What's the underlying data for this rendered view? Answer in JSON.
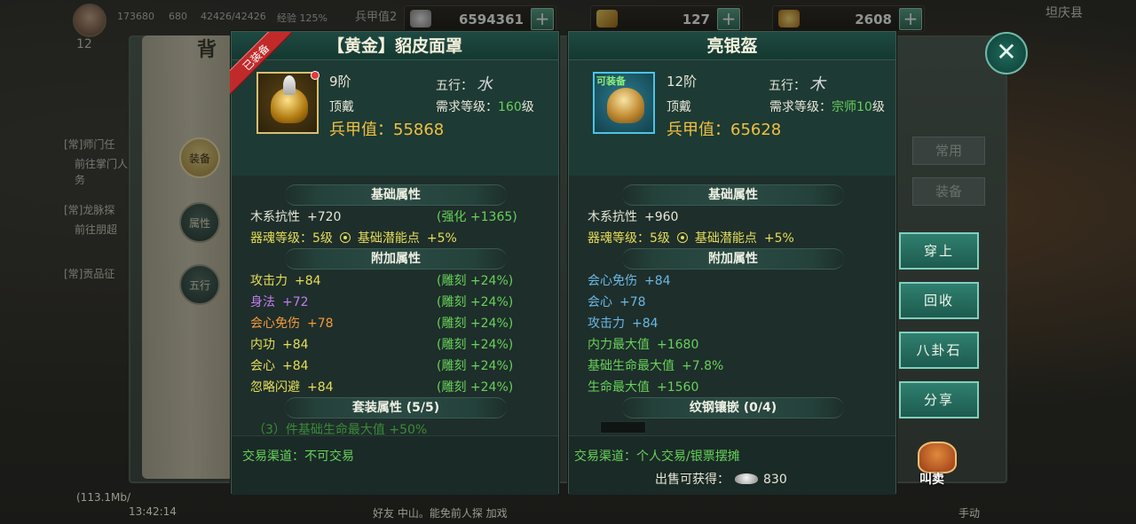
{
  "top_bar": {
    "stats": [
      "173680",
      "680",
      "42426/42426",
      "经验 125%"
    ],
    "armor_label": "兵甲值2",
    "resources": [
      {
        "icon": "silver-ingot-icon",
        "value": "6594361"
      },
      {
        "icon": "gold-bar-icon",
        "value": "127"
      },
      {
        "icon": "gold-ingot-icon",
        "value": "2608"
      }
    ],
    "right_label": "坦庆县"
  },
  "bag": {
    "title": "背",
    "side_tabs": [
      "装备",
      "属性",
      "五行"
    ],
    "right_tabs": [
      "常用",
      "装备"
    ],
    "actions": [
      "穿上",
      "回收",
      "八卦石",
      "分享"
    ],
    "sell_label": "叫卖"
  },
  "left_hud": {
    "quests": [
      "[常]师门任",
      "前往掌门人",
      "务",
      "[常]龙脉探",
      "前往朋超",
      "[常]贡品征"
    ],
    "level": "12"
  },
  "bottom": {
    "net": "(113.1Mb/",
    "time": "13:42:14",
    "chat": "好友    中山。能免前人探  加戏",
    "auto": "手动"
  },
  "card_left": {
    "equipped_ribbon": "已装备",
    "title": "【黄金】貂皮面罩",
    "tier": "9阶",
    "element_label": "五行：",
    "element_value": "水",
    "slot": "顶戴",
    "req_label": "需求等级：",
    "req_value": "160",
    "req_unit": "级",
    "armor_label": "兵甲值：",
    "armor_value": "55868",
    "basic_head": "基础属性",
    "basic": {
      "name": "木系抗性",
      "value": "+720",
      "bonus": "(强化 +1365)"
    },
    "soul": {
      "label": "器魂等级：5级",
      "potential": "基础潜能点",
      "potential_value": "+5%"
    },
    "extra_head": "附加属性",
    "extra": [
      {
        "name": "攻击力",
        "value": "+84",
        "bonus": "(雕刻 +24%)",
        "color": "yellow"
      },
      {
        "name": "身法",
        "value": "+72",
        "bonus": "(雕刻 +24%)",
        "color": "purple"
      },
      {
        "name": "会心免伤",
        "value": "+78",
        "bonus": "(雕刻 +24%)",
        "color": "orange"
      },
      {
        "name": "内功",
        "value": "+84",
        "bonus": "(雕刻 +24%)",
        "color": "yellow"
      },
      {
        "name": "会心",
        "value": "+84",
        "bonus": "(雕刻 +24%)",
        "color": "yellow"
      },
      {
        "name": "忽略闪避",
        "value": "+84",
        "bonus": "(雕刻 +24%)",
        "color": "yellow"
      }
    ],
    "set_head": "套装属性 (5/5)",
    "set_row": "（3）件基础生命最大值  +50%",
    "trade": "交易渠道：不可交易"
  },
  "card_right": {
    "equip_tag": "可装备",
    "title": "亮银盔",
    "tier": "12阶",
    "element_label": "五行：",
    "element_value": "木",
    "slot": "顶戴",
    "req_label": "需求等级：",
    "req_value": "宗师10",
    "req_unit": "级",
    "armor_label": "兵甲值：",
    "armor_value": "65628",
    "basic_head": "基础属性",
    "basic": {
      "name": "木系抗性",
      "value": "+960"
    },
    "soul": {
      "label": "器魂等级：5级",
      "potential": "基础潜能点",
      "potential_value": "+5%"
    },
    "extra_head": "附加属性",
    "extra": [
      {
        "name": "会心免伤",
        "value": "+84"
      },
      {
        "name": "会心",
        "value": "+78"
      },
      {
        "name": "攻击力",
        "value": "+84"
      },
      {
        "name": "内力最大值",
        "value": "+1680"
      },
      {
        "name": "基础生命最大值",
        "value": "+7.8%"
      },
      {
        "name": "生命最大值",
        "value": "+1560"
      }
    ],
    "socket_head": "纹钢镶嵌 (0/4)",
    "trade": "交易渠道：个人交易/银票摆摊",
    "sell_label": "出售可获得：",
    "sell_value": "830"
  }
}
